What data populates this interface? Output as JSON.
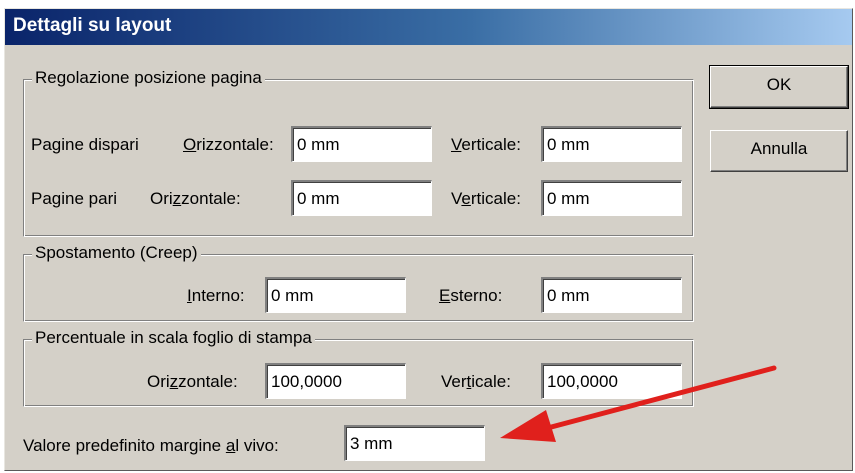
{
  "dialog": {
    "title": "Dettagli su layout"
  },
  "buttons": {
    "ok": "OK",
    "cancel": "Annulla"
  },
  "page_position": {
    "group_label": "Regolazione posizione pagina",
    "odd": {
      "row_label": "Pagine dispari",
      "h_pre": "",
      "h_key": "O",
      "h_post": "rizzontale:",
      "h_value": "0 mm",
      "v_pre": "",
      "v_key": "V",
      "v_post": "erticale:",
      "v_value": "0 mm"
    },
    "even": {
      "row_label": "Pagine pari",
      "h_pre": "Ori",
      "h_key": "z",
      "h_post": "zontale:",
      "h_value": "0 mm",
      "v_pre": "V",
      "v_key": "e",
      "v_post": "rticale:",
      "v_value": "0 mm"
    }
  },
  "creep": {
    "group_label": "Spostamento (Creep)",
    "inner_key": "I",
    "inner_post": "nterno:",
    "inner_value": "0 mm",
    "outer_key": "E",
    "outer_post": "sterno:",
    "outer_value": "0 mm"
  },
  "scale": {
    "group_label": "Percentuale in scala foglio di stampa",
    "h_pre": "Ori",
    "h_key": "z",
    "h_post": "zontale:",
    "h_value": "100,0000",
    "v_pre": "Ver",
    "v_key": "t",
    "v_post": "icale:",
    "v_value": "100,0000"
  },
  "bleed": {
    "pre": "Valore predefinito margine ",
    "key": "a",
    "post": "l vivo:",
    "value": "3 mm"
  },
  "annotation": {
    "arrow_color": "#e0201c"
  }
}
